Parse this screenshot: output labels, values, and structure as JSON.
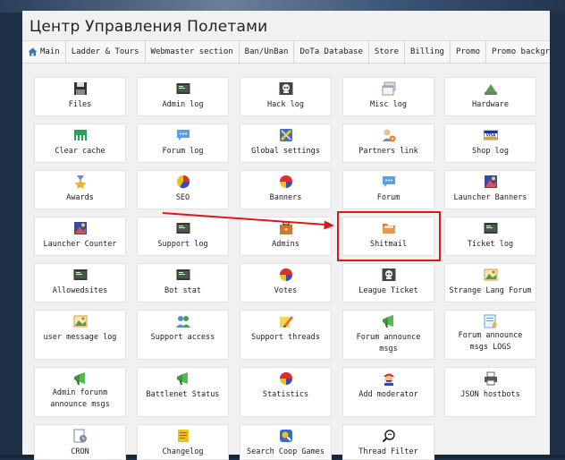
{
  "app": {
    "title": "Центр Управления Полетами"
  },
  "nav": {
    "items": [
      {
        "label": "Main",
        "icon": "home-icon"
      },
      {
        "label": "Ladder & Tours"
      },
      {
        "label": "Webmaster section"
      },
      {
        "label": "Ban/UnBan"
      },
      {
        "label": "DoTa Database"
      },
      {
        "label": "Store"
      },
      {
        "label": "Billing"
      },
      {
        "label": "Promo"
      },
      {
        "label": "Promo background"
      }
    ]
  },
  "tiles": {
    "files": {
      "label": "Files",
      "icon": "floppy-disk-icon"
    },
    "admin_log": {
      "label": "Admin log",
      "icon": "terminal-icon"
    },
    "hack_log": {
      "label": "Hack log",
      "icon": "skull-terminal-icon"
    },
    "misc_log": {
      "label": "Misc log",
      "icon": "window-stack-icon"
    },
    "hardware": {
      "label": "Hardware",
      "icon": "hardware-icon"
    },
    "clear_cache": {
      "label": "Clear cache",
      "icon": "chip-icon"
    },
    "forum_log": {
      "label": "Forum log",
      "icon": "chat-bubble-icon"
    },
    "global_settings": {
      "label": "Global settings",
      "icon": "tools-icon"
    },
    "partners_link": {
      "label": "Partners link",
      "icon": "user-add-icon"
    },
    "shop_log": {
      "label": "Shop log",
      "icon": "visa-card-icon"
    },
    "awards": {
      "label": "Awards",
      "icon": "medal-icon"
    },
    "seo": {
      "label": "SEO",
      "icon": "pie-chart-icon"
    },
    "banners": {
      "label": "Banners",
      "icon": "pie-chart-icon"
    },
    "forum": {
      "label": "Forum",
      "icon": "chat-bubble-icon"
    },
    "launcher_banners": {
      "label": "Launcher Banners",
      "icon": "image-icon"
    },
    "launcher_counter": {
      "label": "Launcher Counter",
      "icon": "image-icon"
    },
    "support_log": {
      "label": "Support log",
      "icon": "terminal-icon"
    },
    "admins": {
      "label": "Admins",
      "icon": "briefcase-icon"
    },
    "shitmail": {
      "label": "Shitmail",
      "icon": "folder-open-icon"
    },
    "ticket_log": {
      "label": "Ticket log",
      "icon": "terminal-icon"
    },
    "allowedsites": {
      "label": "Allowedsites",
      "icon": "terminal-icon"
    },
    "bot_stat": {
      "label": "Bot stat",
      "icon": "terminal-icon"
    },
    "votes": {
      "label": "Votes",
      "icon": "pie-chart-icon"
    },
    "league_ticket": {
      "label": "League Ticket",
      "icon": "skull-terminal-icon"
    },
    "strange_lang_forum": {
      "label": "Strange Lang Forum",
      "icon": "photo-icon"
    },
    "user_message_log": {
      "label": "user message log",
      "icon": "photo-icon"
    },
    "support_access": {
      "label": "Support access",
      "icon": "users-icon"
    },
    "support_threads": {
      "label": "Support threads",
      "icon": "pencil-note-icon"
    },
    "forum_announce_msgs": {
      "label": "Forum announce msgs",
      "icon": "megaphone-icon"
    },
    "forum_announce_msgs_logs": {
      "label": "Forum announce msgs LOGS",
      "icon": "star-document-icon"
    },
    "admin_forum_announce_msgs": {
      "label": "Admin forunm announce msgs",
      "icon": "megaphone-icon"
    },
    "battlenet_status": {
      "label": "Battlenet Status",
      "icon": "megaphone-icon"
    },
    "statistics": {
      "label": "Statistics",
      "icon": "pie-chart-icon"
    },
    "add_moderator": {
      "label": "Add moderator",
      "icon": "mario-icon"
    },
    "json_hostbots": {
      "label": "JSON hostbots",
      "icon": "printer-icon"
    },
    "cron": {
      "label": "CRON",
      "icon": "document-clock-icon"
    },
    "changelog": {
      "label": "Changelog",
      "icon": "notebook-icon"
    },
    "search_coop_games": {
      "label": "Search Coop Games",
      "icon": "game-search-icon"
    },
    "thread_filter": {
      "label": "Thread Filter",
      "icon": "magnifier-icon"
    }
  },
  "colors": {
    "annotation": "#d9191d",
    "panel": "#f1f1f1",
    "page_bg": "#1c2f45"
  }
}
